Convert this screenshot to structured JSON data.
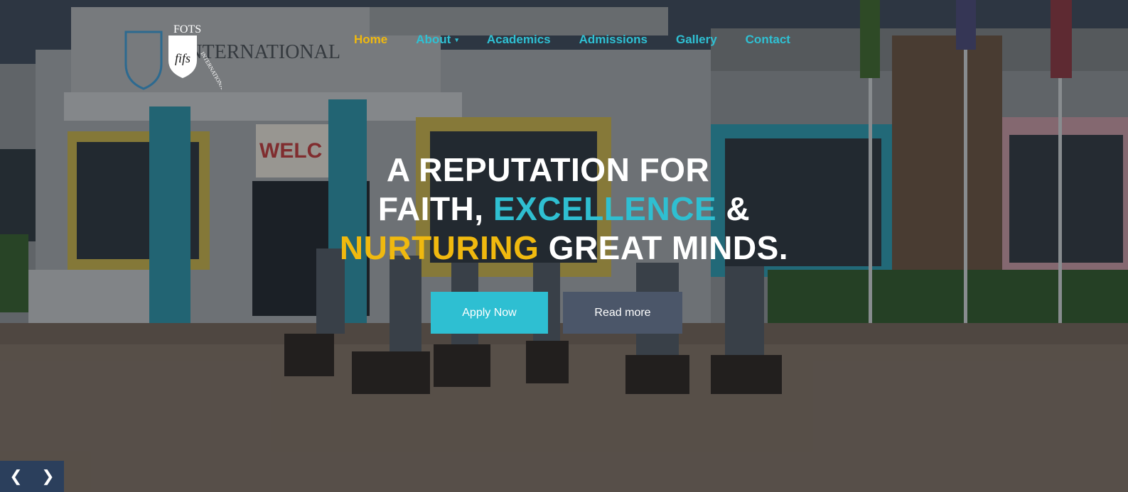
{
  "brand": {
    "name": "FOTS",
    "school_arc": "INTERNATIONAL SCHOOL",
    "wall_sign": "INTERNATIONAL",
    "monogram": "fifs"
  },
  "nav": {
    "items": [
      {
        "label": "Home",
        "active": true
      },
      {
        "label": "About",
        "dropdown": true
      },
      {
        "label": "Academics"
      },
      {
        "label": "Admissions"
      },
      {
        "label": "Gallery"
      },
      {
        "label": "Contact"
      }
    ]
  },
  "hero": {
    "line1": "A REPUTATION FOR",
    "line2_a": "FAITH, ",
    "line2_b": "EXCELLENCE",
    "line2_c": " &",
    "line3_a": "NURTURING",
    "line3_b": " GREAT MINDS.",
    "apply_label": "Apply Now",
    "read_label": "Read more",
    "wall_welcome": "WELC"
  },
  "slider": {
    "prev_icon": "chevron-left-icon",
    "next_icon": "chevron-right-icon"
  },
  "colors": {
    "cyan": "#2fbfd1",
    "gold": "#f0b90f",
    "apply_bg": "#2ebfd2",
    "read_bg": "#4b5669",
    "slider_bg": "#2b3f5c"
  }
}
